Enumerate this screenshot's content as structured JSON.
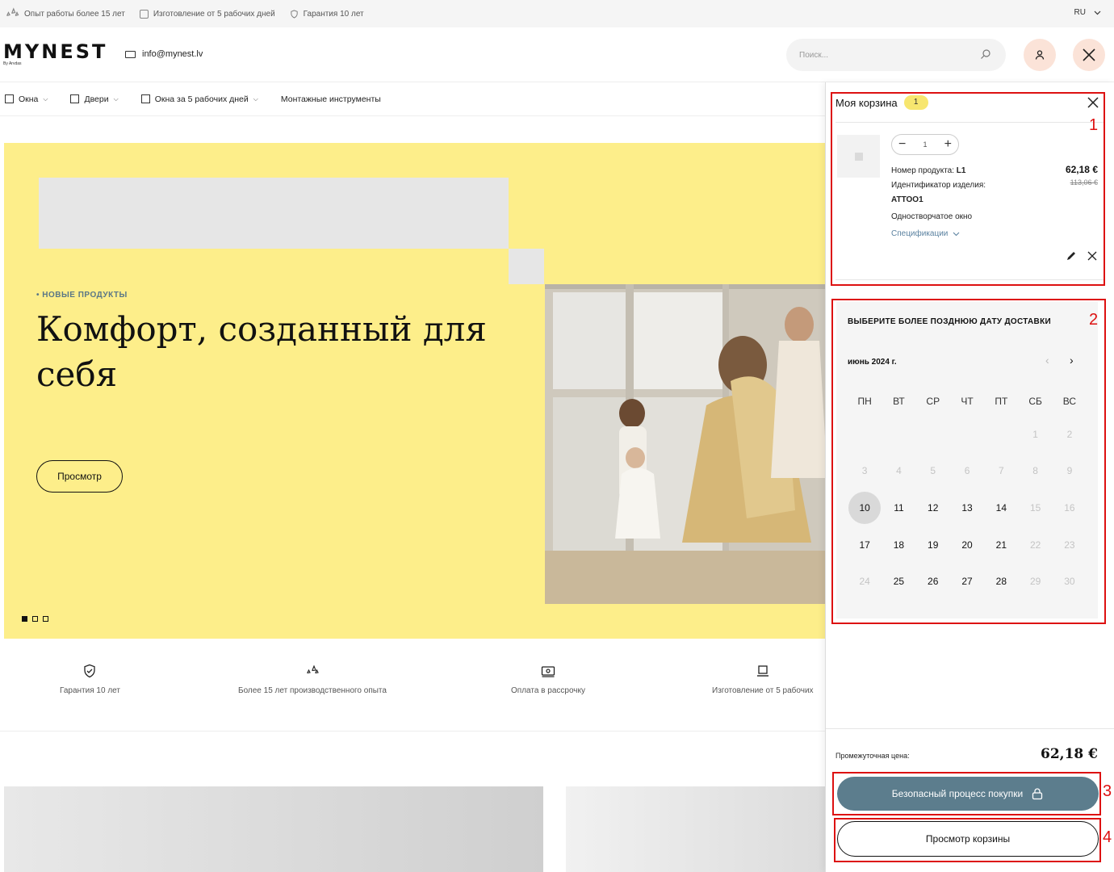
{
  "topbar": {
    "items": [
      "Опыт работы более 15 лет",
      "Изготовление от 5 рабочих дней",
      "Гарантия 10 лет"
    ],
    "lang": "RU"
  },
  "header": {
    "logo": "MYNEST",
    "logo_sub": "By Arvdas",
    "email": "info@mynest.lv",
    "search_placeholder": "Поиск..."
  },
  "nav": {
    "items": [
      "Окна",
      "Двери",
      "Окна за 5 рабочих дней",
      "Монтажные инструменты"
    ]
  },
  "hero": {
    "tag": "• НОВЫЕ ПРОДУКТЫ",
    "title": "Комфорт, созданный для себя",
    "button": "Просмотр"
  },
  "features": [
    "Гарантия 10 лет",
    "Более 15 лет производственного опыта",
    "Оплата в рассрочку",
    "Изготовление от 5 рабочих"
  ],
  "cart": {
    "title": "Моя корзина",
    "count": "1",
    "item": {
      "quantity": "1",
      "product_number_label": "Номер продукта:",
      "product_number": "L1",
      "item_id_label": "Идентификатор изделия:",
      "item_id": "ATTOO1",
      "description": "Одностворчатое окно",
      "specs": "Спецификации",
      "price": "62,18 €",
      "old_price": "113,06 €"
    },
    "calendar": {
      "title": "ВЫБЕРИТЕ БОЛЕЕ ПОЗДНЮЮ ДАТУ ДОСТАВКИ",
      "month": "июнь 2024 г.",
      "weekdays": [
        "ПН",
        "ВТ",
        "СР",
        "ЧТ",
        "ПТ",
        "СБ",
        "ВС"
      ],
      "leading_blanks": 5,
      "days": [
        {
          "d": "1",
          "off": true
        },
        {
          "d": "2",
          "off": true
        },
        {
          "d": "3",
          "off": true
        },
        {
          "d": "4",
          "off": true
        },
        {
          "d": "5",
          "off": true
        },
        {
          "d": "6",
          "off": true
        },
        {
          "d": "7",
          "off": true
        },
        {
          "d": "8",
          "off": true
        },
        {
          "d": "9",
          "off": true
        },
        {
          "d": "10",
          "sel": true
        },
        {
          "d": "11"
        },
        {
          "d": "12"
        },
        {
          "d": "13"
        },
        {
          "d": "14"
        },
        {
          "d": "15",
          "off": true
        },
        {
          "d": "16",
          "off": true
        },
        {
          "d": "17"
        },
        {
          "d": "18"
        },
        {
          "d": "19"
        },
        {
          "d": "20"
        },
        {
          "d": "21"
        },
        {
          "d": "22",
          "off": true
        },
        {
          "d": "23",
          "off": true
        },
        {
          "d": "24",
          "off": true
        },
        {
          "d": "25"
        },
        {
          "d": "26"
        },
        {
          "d": "27"
        },
        {
          "d": "28"
        },
        {
          "d": "29",
          "off": true
        },
        {
          "d": "30",
          "off": true
        }
      ]
    },
    "subtotal_label": "Промежуточная цена:",
    "subtotal": "62,18 €",
    "checkout": "Безопасный процесс покупки",
    "view_cart": "Просмотр корзины"
  },
  "markers": [
    "1",
    "2",
    "3",
    "4"
  ],
  "colors": {
    "accent_yellow": "#fdee8a",
    "button_blue": "#5c7d8d",
    "annotation_red": "#dd1111"
  }
}
